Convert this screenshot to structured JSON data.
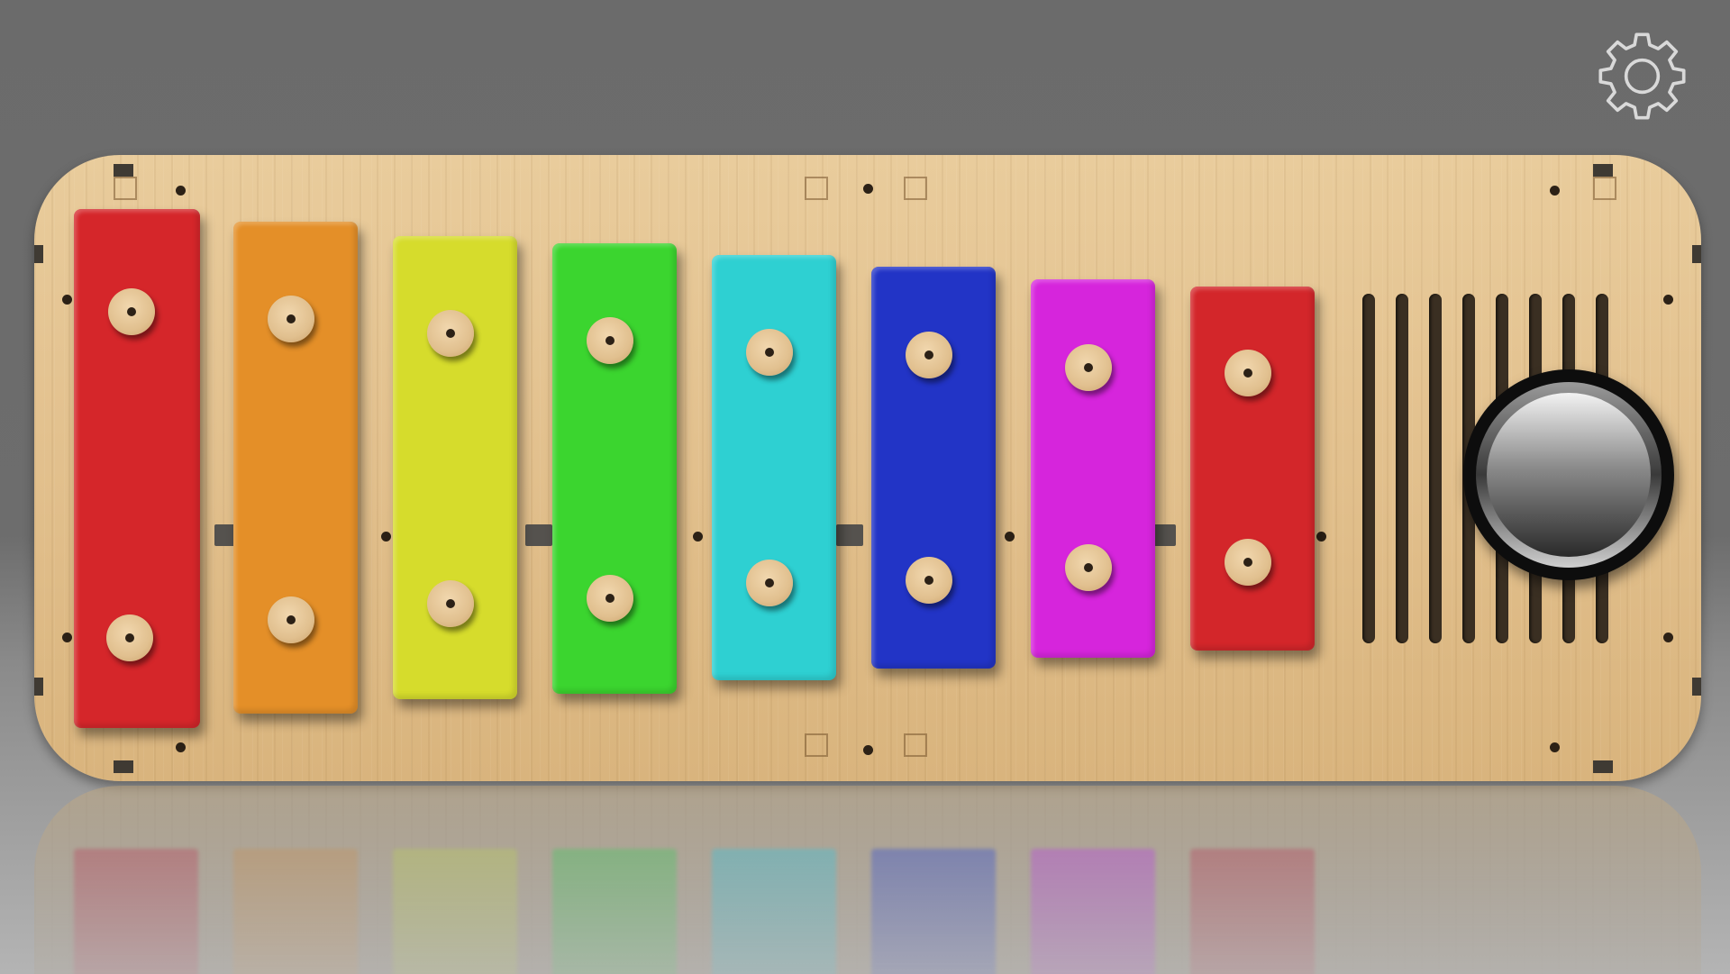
{
  "app": {
    "settings_icon": "gear-icon",
    "play_icon": "round-play-button-icon"
  },
  "xylophone": {
    "bars": [
      {
        "color": "#d5262a",
        "index": 1
      },
      {
        "color": "#e48f28",
        "index": 2
      },
      {
        "color": "#d6dc2c",
        "index": 3
      },
      {
        "color": "#3bd52f",
        "index": 4
      },
      {
        "color": "#2ed0d2",
        "index": 5
      },
      {
        "color": "#2234c6",
        "index": 6
      },
      {
        "color": "#d625dc",
        "index": 7
      },
      {
        "color": "#d3262a",
        "index": 8
      }
    ],
    "board_color": "#e3c18f",
    "speaker_slots": 8
  }
}
